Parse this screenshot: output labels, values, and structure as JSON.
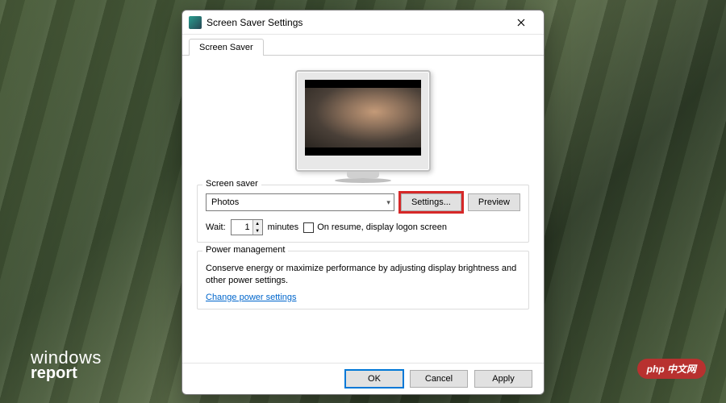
{
  "dialog": {
    "title": "Screen Saver Settings",
    "tab": "Screen Saver",
    "group_screensaver_title": "Screen saver",
    "dropdown_value": "Photos",
    "settings_button": "Settings...",
    "preview_button": "Preview",
    "wait_label": "Wait:",
    "wait_value": "1",
    "minutes_label": "minutes",
    "resume_checkbox": "On resume, display logon screen",
    "group_power_title": "Power management",
    "power_text": "Conserve energy or maximize performance by adjusting display brightness and other power settings.",
    "power_link": "Change power settings",
    "ok_button": "OK",
    "cancel_button": "Cancel",
    "apply_button": "Apply"
  },
  "watermarks": {
    "wr_line1": "windows",
    "wr_line2": "report",
    "php": "php 中文网"
  }
}
